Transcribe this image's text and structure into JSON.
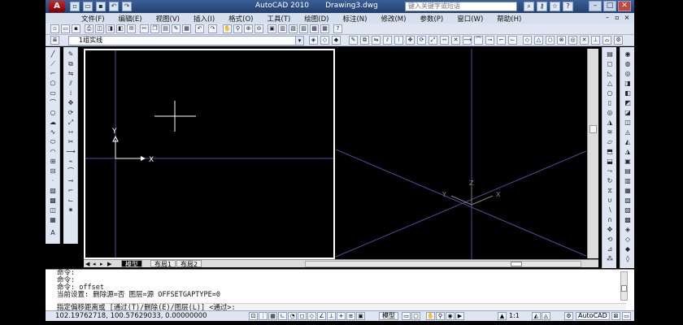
{
  "title_bar": {
    "logo_letter": "A",
    "app_title": "AutoCAD 2010",
    "document_title": "Drawing3.dwg",
    "search_placeholder": "键入关键字或短语"
  },
  "menu": {
    "items": [
      "文件(F)",
      "编辑(E)",
      "视图(V)",
      "插入(I)",
      "格式(O)",
      "工具(T)",
      "绘图(D)",
      "标注(N)",
      "修改(M)",
      "参数(P)",
      "窗口(W)",
      "帮助(H)"
    ]
  },
  "layer_toolbar": {
    "current_layer": "1组实线"
  },
  "viewports": {
    "left_axis_y": "Y",
    "left_axis_x": "X",
    "right_axis_z": "Z",
    "right_axis_y": "Y",
    "right_axis_x": "X"
  },
  "layout_tabs": {
    "tabs": [
      "模型",
      "布局1",
      "布局2"
    ],
    "active_index": 0
  },
  "command_history": [
    "命令:",
    "命令:",
    "命令:  offset",
    "当前设置: 删除源=否  图层=源  OFFSETGAPTYPE=0"
  ],
  "command_prompt": "指定偏移距离或 [通过(T)/删除(E)/图层(L)] <通过>:",
  "status_bar": {
    "coordinates": "102.19762718,  100.57629033, 0.00000000",
    "model_label": "模型",
    "annotation_scale": "1:1",
    "workspace": "AutoCAD"
  }
}
